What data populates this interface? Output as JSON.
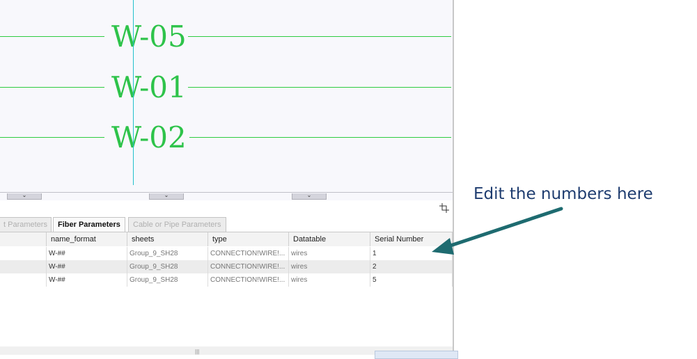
{
  "canvas": {
    "wires": [
      {
        "label": "W-05"
      },
      {
        "label": "W-01"
      },
      {
        "label": "W-02"
      }
    ]
  },
  "tabs": [
    {
      "label": "t Parameters",
      "active": false
    },
    {
      "label": "Fiber Parameters",
      "active": true
    },
    {
      "label": "Cable or Pipe Parameters",
      "active": false
    }
  ],
  "table": {
    "columns": [
      "",
      "name_format",
      "sheets",
      "type",
      "Datatable",
      "Serial Number"
    ],
    "rows": [
      [
        "",
        "W-##",
        "Group_9_SH28",
        "CONNECTION!WIRE!...",
        "wires",
        "1"
      ],
      [
        "",
        "W-##",
        "Group_9_SH28",
        "CONNECTION!WIRE!...",
        "wires",
        "2"
      ],
      [
        "",
        "W-##",
        "Group_9_SH28",
        "CONNECTION!WIRE!...",
        "wires",
        "5"
      ]
    ]
  },
  "annotation": {
    "text": "Edit the numbers here",
    "color": "#1f3d70",
    "arrow_color": "#1e6b70"
  },
  "icons": {
    "corner": "resize-corner-icon",
    "scroll_grip": "grip-icon"
  }
}
